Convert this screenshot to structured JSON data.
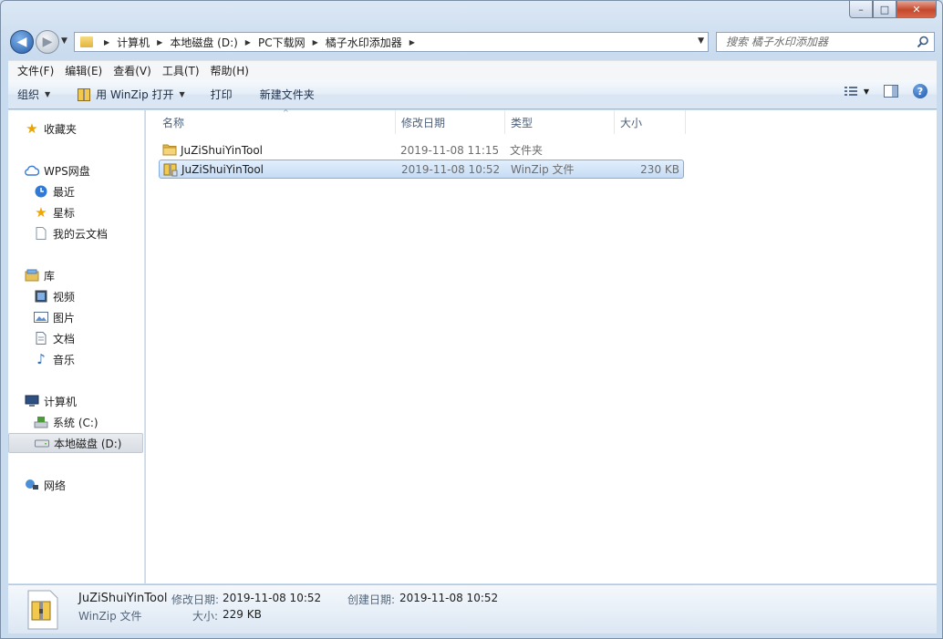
{
  "window": {
    "caption_minimize": "–",
    "caption_maximize": "□",
    "caption_close": "✕"
  },
  "address": {
    "back_glyph": "◀",
    "forward_glyph": "▶",
    "history_glyph": "▼",
    "breadcrumbs": [
      "计算机",
      "本地磁盘 (D:)",
      "PC下载网",
      "橘子水印添加器"
    ],
    "separator": "▶",
    "dropdown_glyph": "▼",
    "refresh_glyph": "⟳",
    "search_placeholder": "搜索 橘子水印添加器"
  },
  "menu": {
    "items": [
      "文件(F)",
      "编辑(E)",
      "查看(V)",
      "工具(T)",
      "帮助(H)"
    ]
  },
  "commands": {
    "organize": "组织",
    "open_with": "用 WinZip 打开",
    "print": "打印",
    "new_folder": "新建文件夹",
    "dropdown_glyph": "▼",
    "help_glyph": "?"
  },
  "nav": {
    "favorites": "收藏夹",
    "wps_cloud": "WPS网盘",
    "recent": "最近",
    "starred": "星标",
    "my_cloud_docs": "我的云文档",
    "libraries": "库",
    "videos": "视频",
    "pictures": "图片",
    "documents": "文档",
    "music": "音乐",
    "computer": "计算机",
    "system_c": "系统 (C:)",
    "local_d": "本地磁盘 (D:)",
    "network": "网络"
  },
  "columns": {
    "name": "名称",
    "modified": "修改日期",
    "type": "类型",
    "size": "大小",
    "sort_glyph": "^"
  },
  "files": [
    {
      "name": "JuZiShuiYinTool",
      "modified": "2019-11-08 11:15",
      "type": "文件夹",
      "size": "",
      "icon": "folder-icon"
    },
    {
      "name": "JuZiShuiYinTool",
      "modified": "2019-11-08 10:52",
      "type": "WinZip 文件",
      "size": "230 KB",
      "icon": "winzip-icon"
    }
  ],
  "details": {
    "name": "JuZiShuiYinTool",
    "type": "WinZip 文件",
    "modified_label": "修改日期:",
    "modified_value": "2019-11-08 10:52",
    "created_label": "创建日期:",
    "created_value": "2019-11-08 10:52",
    "size_label": "大小:",
    "size_value": "229 KB"
  },
  "colors": {
    "selection_bg": "#cce2f8",
    "selection_border": "#84acdd",
    "accent": "#2459a8"
  }
}
